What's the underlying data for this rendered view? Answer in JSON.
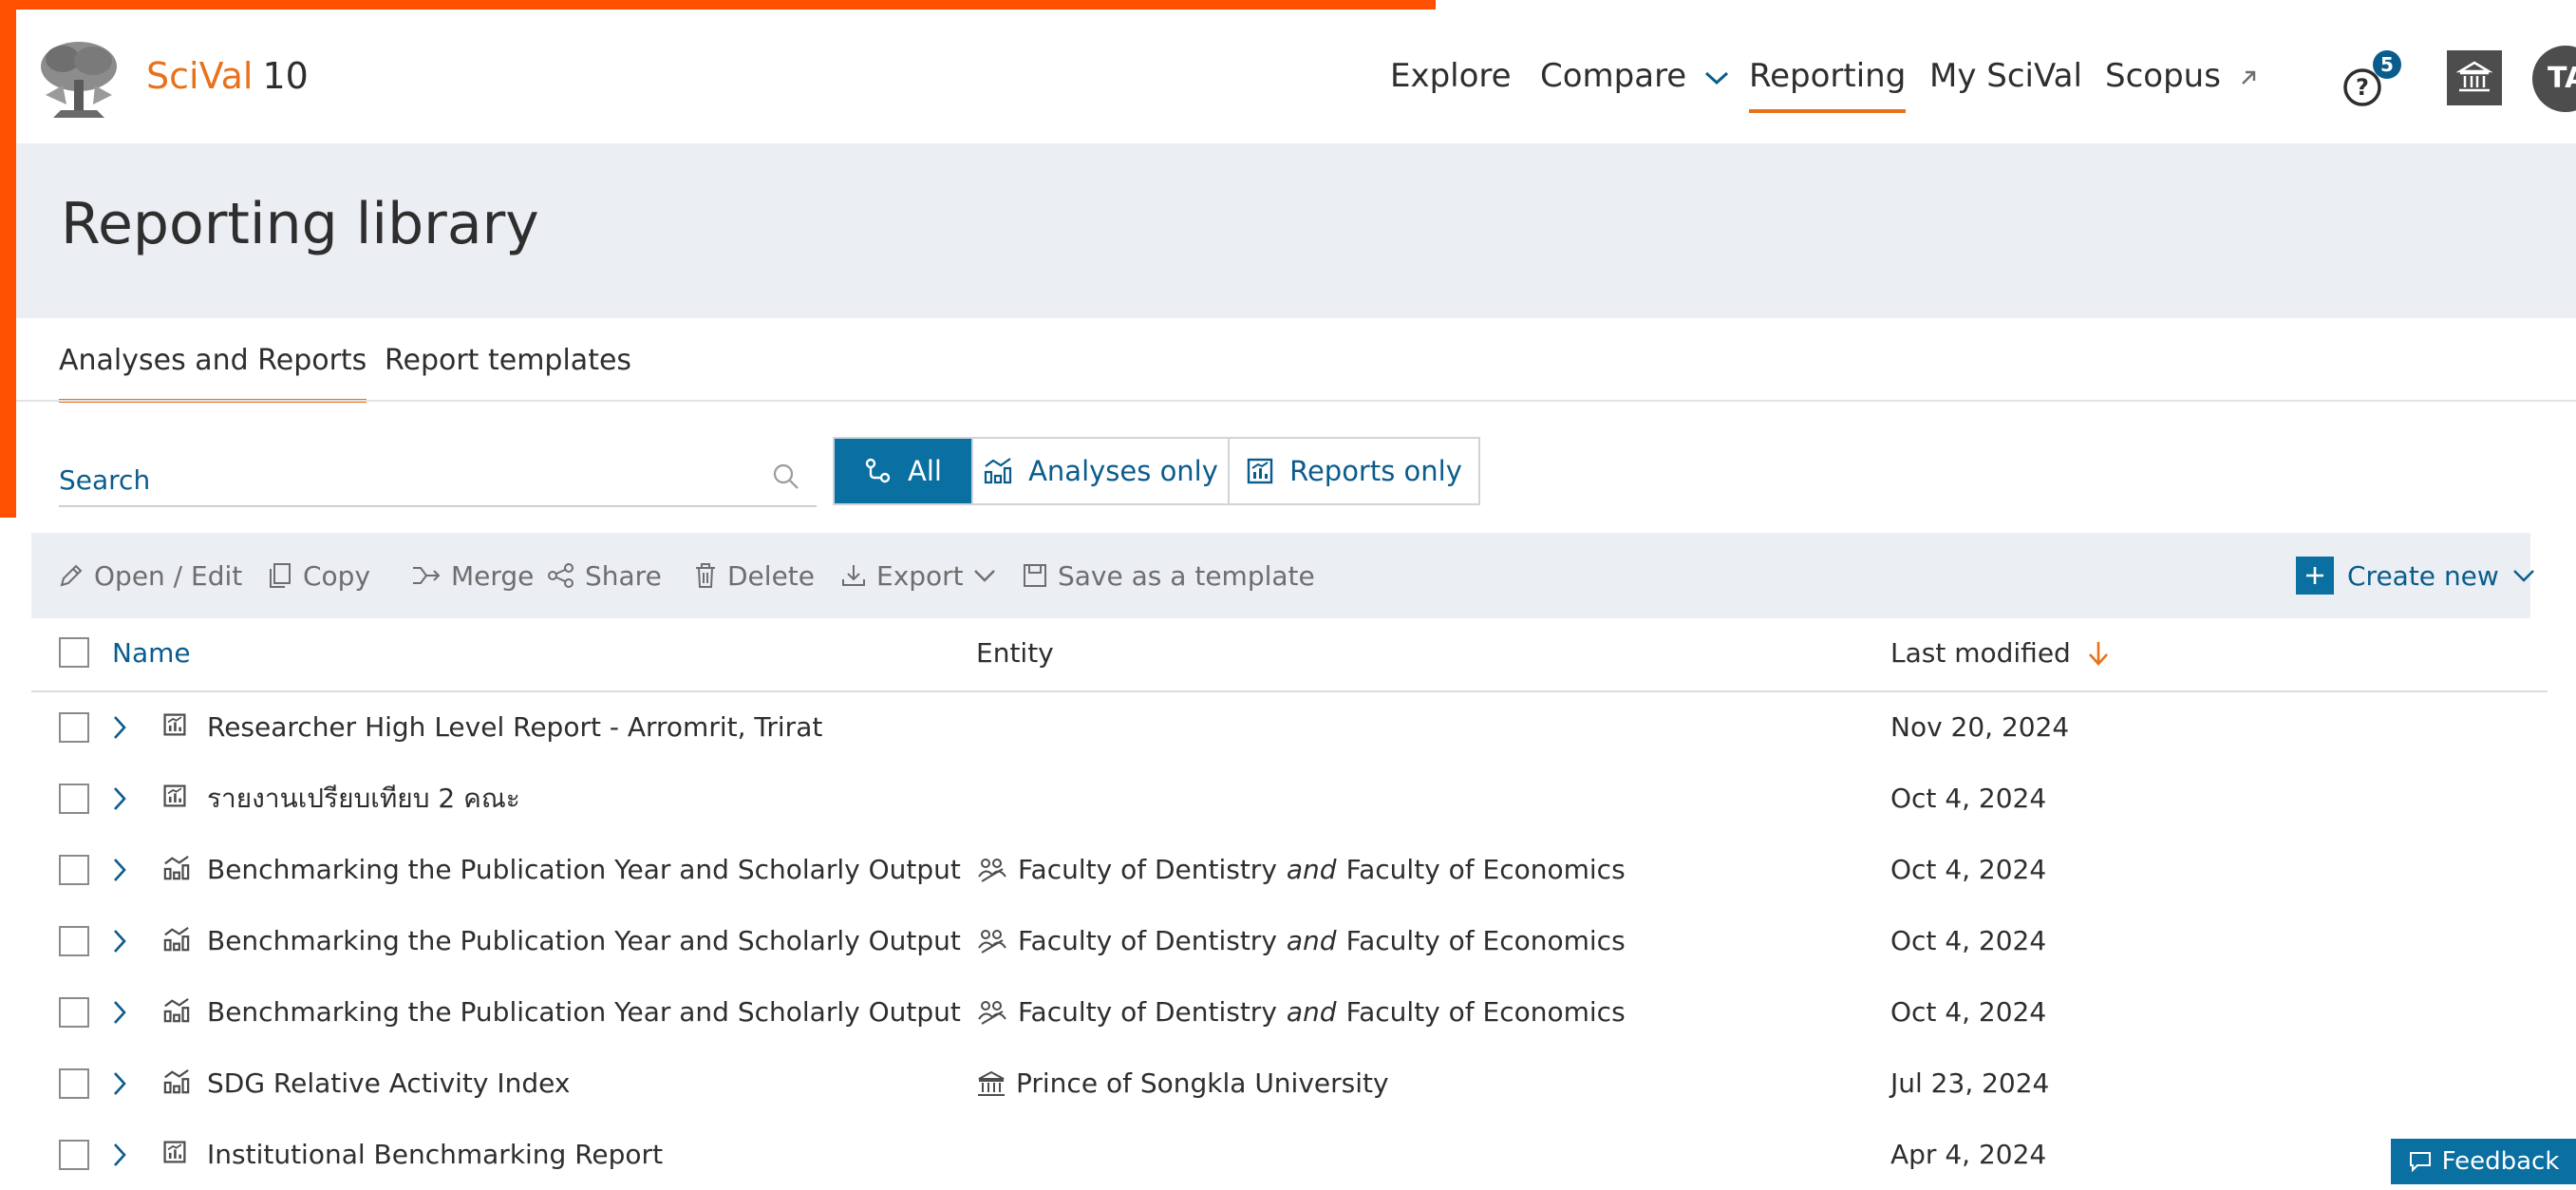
{
  "header": {
    "brand_name": "SciVal",
    "brand_version": "10",
    "nav": [
      {
        "label": "Explore"
      },
      {
        "label": "Compare"
      },
      {
        "label": "Reporting"
      },
      {
        "label": "My SciVal"
      },
      {
        "label": "Scopus"
      }
    ],
    "help_badge": "5",
    "avatar_initials": "TA"
  },
  "page": {
    "title": "Reporting library"
  },
  "tabs": [
    {
      "label": "Analyses and Reports",
      "active": true
    },
    {
      "label": "Report templates",
      "active": false
    }
  ],
  "search": {
    "placeholder": "Search"
  },
  "filters": [
    {
      "label": "All",
      "icon": "network-icon",
      "selected": true
    },
    {
      "label": "Analyses only",
      "icon": "analysis-chart-icon",
      "selected": false
    },
    {
      "label": "Reports only",
      "icon": "report-icon",
      "selected": false
    }
  ],
  "toolbar": {
    "open_edit": "Open / Edit",
    "copy": "Copy",
    "merge": "Merge",
    "share": "Share",
    "delete": "Delete",
    "export": "Export",
    "save_template": "Save as a template",
    "create_new": "Create new"
  },
  "table": {
    "columns": {
      "name": "Name",
      "entity": "Entity",
      "last_modified": "Last modified"
    },
    "rows": [
      {
        "type": "report",
        "name": "Researcher High Level Report - Arromrit, Trirat",
        "entity_a": "",
        "entity_joiner": "",
        "entity_b": "",
        "entity_icon": "",
        "date": "Nov 20, 2024"
      },
      {
        "type": "report",
        "name": "รายงานเปรียบเทียบ 2 คณะ",
        "entity_a": "",
        "entity_joiner": "",
        "entity_b": "",
        "entity_icon": "",
        "date": "Oct 4, 2024"
      },
      {
        "type": "analysis",
        "name": "Benchmarking the Publication Year and Scholarly Output",
        "entity_a": "Faculty of Dentistry",
        "entity_joiner": "and",
        "entity_b": "Faculty of Economics",
        "entity_icon": "group-icon",
        "date": "Oct 4, 2024"
      },
      {
        "type": "analysis",
        "name": "Benchmarking the Publication Year and Scholarly Output",
        "entity_a": "Faculty of Dentistry",
        "entity_joiner": "and",
        "entity_b": "Faculty of Economics",
        "entity_icon": "group-icon",
        "date": "Oct 4, 2024"
      },
      {
        "type": "analysis",
        "name": "Benchmarking the Publication Year and Scholarly Output",
        "entity_a": "Faculty of Dentistry",
        "entity_joiner": "and",
        "entity_b": "Faculty of Economics",
        "entity_icon": "group-icon",
        "date": "Oct 4, 2024"
      },
      {
        "type": "analysis",
        "name": "SDG Relative Activity Index",
        "entity_a": "Prince of Songkla University",
        "entity_joiner": "",
        "entity_b": "",
        "entity_icon": "institution-icon",
        "date": "Jul 23, 2024"
      },
      {
        "type": "report",
        "name": "Institutional Benchmarking Report",
        "entity_a": "",
        "entity_joiner": "",
        "entity_b": "",
        "entity_icon": "",
        "date": "Apr 4, 2024"
      }
    ]
  },
  "feedback": {
    "label": "Feedback"
  },
  "colors": {
    "brand_orange": "#e9711c",
    "accent_orange": "#ff4f00",
    "primary_blue": "#0a6fa1",
    "link_blue": "#0a5c8d"
  }
}
